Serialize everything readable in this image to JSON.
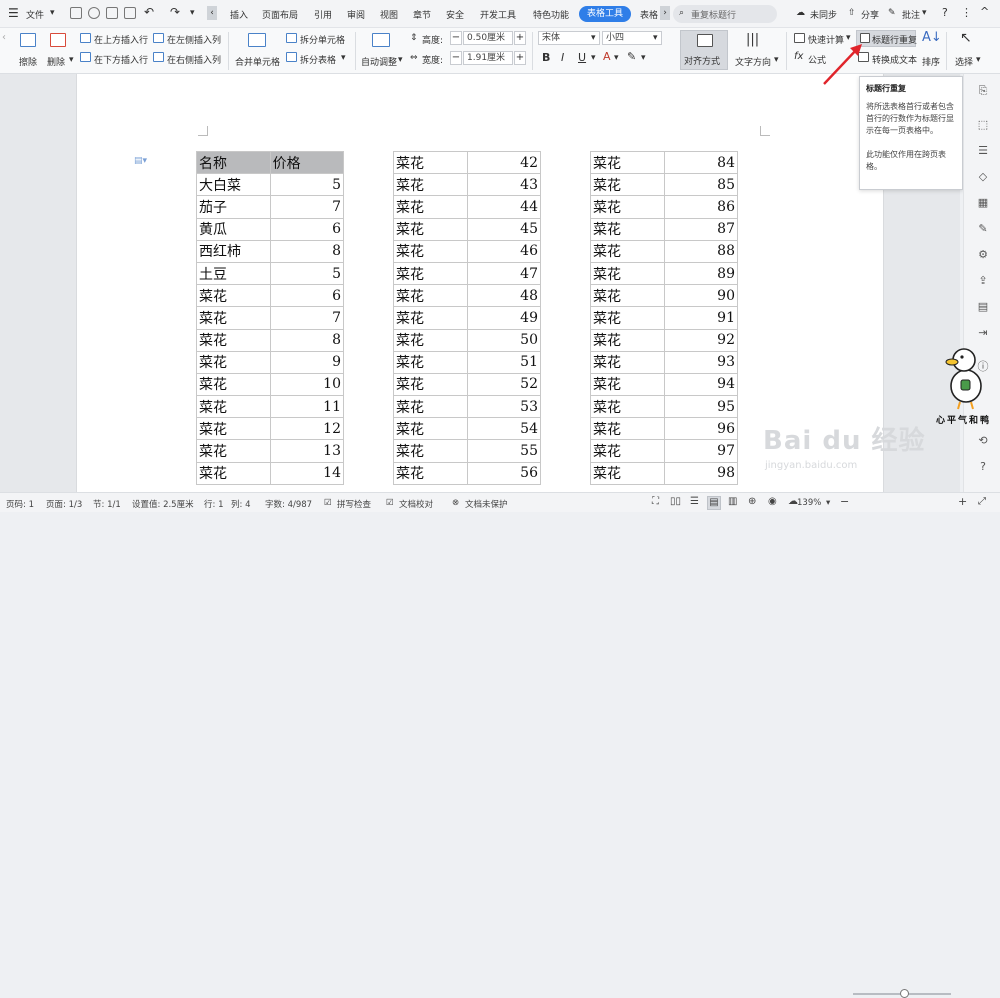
{
  "menubar": {
    "menu_label": "文件",
    "tabs": [
      "插入",
      "页面布局",
      "引用",
      "审阅",
      "视图",
      "章节",
      "安全",
      "开发工具",
      "特色功能",
      "表格工具",
      "表格"
    ],
    "active_tab": "表格工具",
    "search_placeholder": "重复标题行",
    "sync_label": "未同步",
    "share_label": "分享",
    "comment_label": "批注",
    "help_label": "?",
    "more_label": "⋮"
  },
  "ribbon": {
    "erase": "擦除",
    "delete": "删除",
    "insert_above": "在上方插入行",
    "insert_below": "在下方插入行",
    "insert_left": "在左侧插入列",
    "insert_right": "在右侧插入列",
    "merge": "合并单元格",
    "split_cell": "拆分单元格",
    "split_table": "拆分表格",
    "autofit": "自动调整",
    "height_label": "高度:",
    "height_value": "0.50厘米",
    "width_label": "宽度:",
    "width_value": "1.91厘米",
    "font_name": "宋体",
    "font_size": "小四",
    "bold": "B",
    "italic": "I",
    "underline": "U",
    "align": "对齐方式",
    "text_direction": "文字方向",
    "quick_calc": "快速计算",
    "formula": "公式",
    "repeat_title": "标题行重复",
    "convert_text": "转换成文本",
    "sort": "排序",
    "select": "选择"
  },
  "tooltip": {
    "title": "标题行重复",
    "line1": "将所选表格首行或者包含首行的行数作为标题行显示在每一页表格中。",
    "line2": "此功能仅作用在跨页表格。"
  },
  "table1": {
    "headers": [
      "名称",
      "价格"
    ],
    "rows": [
      [
        "大白菜",
        "5"
      ],
      [
        "茄子",
        "7"
      ],
      [
        "黄瓜",
        "6"
      ],
      [
        "西红柿",
        "8"
      ],
      [
        "土豆",
        "5"
      ],
      [
        "菜花",
        "6"
      ],
      [
        "菜花",
        "7"
      ],
      [
        "菜花",
        "8"
      ],
      [
        "菜花",
        "9"
      ],
      [
        "菜花",
        "10"
      ],
      [
        "菜花",
        "11"
      ],
      [
        "菜花",
        "12"
      ],
      [
        "菜花",
        "13"
      ],
      [
        "菜花",
        "14"
      ]
    ]
  },
  "table2": {
    "rows": [
      [
        "菜花",
        "42"
      ],
      [
        "菜花",
        "43"
      ],
      [
        "菜花",
        "44"
      ],
      [
        "菜花",
        "45"
      ],
      [
        "菜花",
        "46"
      ],
      [
        "菜花",
        "47"
      ],
      [
        "菜花",
        "48"
      ],
      [
        "菜花",
        "49"
      ],
      [
        "菜花",
        "50"
      ],
      [
        "菜花",
        "51"
      ],
      [
        "菜花",
        "52"
      ],
      [
        "菜花",
        "53"
      ],
      [
        "菜花",
        "54"
      ],
      [
        "菜花",
        "55"
      ],
      [
        "菜花",
        "56"
      ]
    ]
  },
  "table3": {
    "rows": [
      [
        "菜花",
        "84"
      ],
      [
        "菜花",
        "85"
      ],
      [
        "菜花",
        "86"
      ],
      [
        "菜花",
        "87"
      ],
      [
        "菜花",
        "88"
      ],
      [
        "菜花",
        "89"
      ],
      [
        "菜花",
        "90"
      ],
      [
        "菜花",
        "91"
      ],
      [
        "菜花",
        "92"
      ],
      [
        "菜花",
        "93"
      ],
      [
        "菜花",
        "94"
      ],
      [
        "菜花",
        "95"
      ],
      [
        "菜花",
        "96"
      ],
      [
        "菜花",
        "97"
      ],
      [
        "菜花",
        "98"
      ]
    ]
  },
  "status": {
    "page_num": "页码: 1",
    "pages": "页面: 1/3",
    "section": "节: 1/1",
    "setting": "设置值: 2.5厘米",
    "row": "行: 1",
    "col": "列: 4",
    "words": "字数: 4/987",
    "spell": "拼写检查",
    "doc_check": "文档校对",
    "protect": "文档未保护",
    "zoom": "139%"
  },
  "sticker_text": "心平气和鸭",
  "watermark": {
    "brand": "Bai du 经验",
    "url": "jingyan.baidu.com"
  },
  "colors": {
    "accent": "#2f7ee8",
    "header_fill": "#b9babc",
    "arrow": "#e0242b"
  }
}
